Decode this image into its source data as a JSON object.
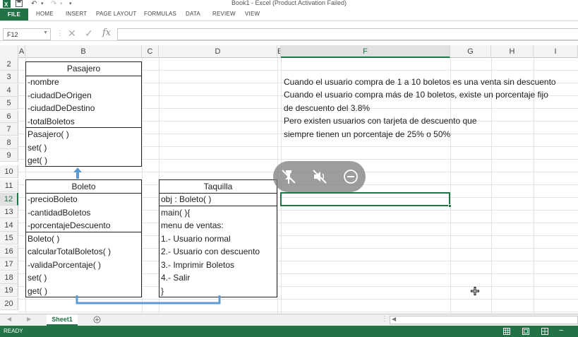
{
  "window": {
    "title": "Book1 - Excel (Product Activation Failed)"
  },
  "ribbon": {
    "tabs": [
      "FILE",
      "HOME",
      "INSERT",
      "PAGE LAYOUT",
      "FORMULAS",
      "DATA",
      "REVIEW",
      "VIEW"
    ]
  },
  "formula_bar": {
    "name_box": "F12",
    "fx": "fx",
    "value": ""
  },
  "columns": [
    "A",
    "B",
    "C",
    "D",
    "E",
    "F",
    "G",
    "H",
    "I"
  ],
  "active_column": "F",
  "rows": [
    "2",
    "3",
    "4",
    "5",
    "6",
    "7",
    "8",
    "9",
    "10",
    "11",
    "12",
    "13",
    "14",
    "15",
    "16",
    "17",
    "18",
    "19",
    "20"
  ],
  "active_row": "12",
  "diagram": {
    "pasajero": {
      "name": "Pasajero",
      "attributes": [
        "-nombre",
        "-ciudadDeOrigen",
        "-ciudadDeDestino",
        "-totalBoletos"
      ],
      "methods": [
        "Pasajero( )",
        "set( )",
        "get( )"
      ]
    },
    "boleto": {
      "name": "Boleto",
      "attributes": [
        "-precioBoleto",
        "-cantidadBoletos",
        "-porcentajeDescuento"
      ],
      "methods": [
        "Boleto( )",
        "calcularTotalBoletos( )",
        "-validaPorcentaje( )",
        "set( )",
        "get( )"
      ]
    },
    "taquilla": {
      "name": "Taquilla",
      "attributes": [
        "obj : Boleto( )"
      ],
      "methods": [
        "main( ){",
        "menu de ventas:",
        "1.- Usuario normal",
        "2.- Usuario con descuento",
        "3.- Imprimir Boletos",
        "4.- Salir",
        "}"
      ]
    }
  },
  "notes": [
    "Cuando el usuario compra de 1 a 10 boletos es una venta sin descuento",
    "Cuando el usuario compra más de 10 boletos, existe un porcentaje fijo",
    "de descuento del 3.8%",
    "Pero existen usuarios con tarjeta de descuento que",
    "siempre tienen un porcentaje de 25% o 50%"
  ],
  "sheet": {
    "tab_label": "Sheet1",
    "add_sheet_icon": "plus-circle-icon"
  },
  "status": {
    "text": "READY"
  },
  "colors": {
    "accent": "#217346",
    "arrow": "#5b9bd5"
  }
}
